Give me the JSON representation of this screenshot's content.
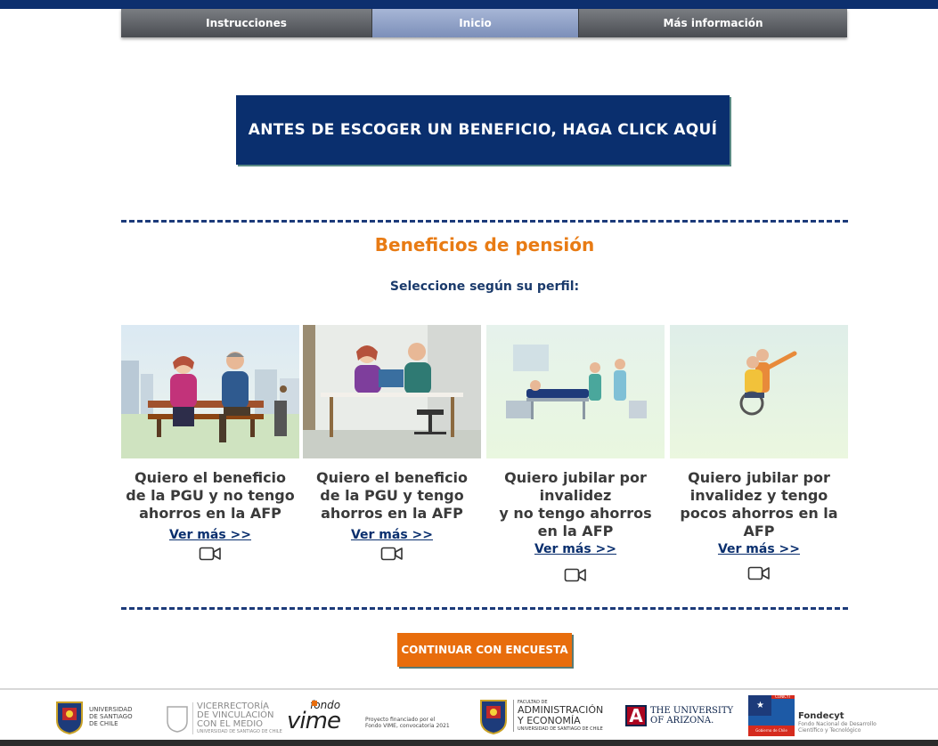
{
  "nav": {
    "tabs": [
      {
        "label": "Instrucciones",
        "active": false
      },
      {
        "label": "Inicio",
        "active": true
      },
      {
        "label": "Más información",
        "active": false
      }
    ]
  },
  "cta": {
    "label": "ANTES DE ESCOGER UN BENEFICIO, HAGA CLICK AQUÍ"
  },
  "section": {
    "title": "Beneficios de pensión",
    "subtitle": "Seleccione según su perfil:"
  },
  "cards": [
    {
      "title_lines": [
        "Quiero el beneficio",
        "de la PGU y no tengo",
        "ahorros en la AFP"
      ],
      "link": "Ver más >>",
      "icon": "video-camera-icon"
    },
    {
      "title_lines": [
        "Quiero el beneficio",
        "de la PGU y tengo",
        "ahorros en la AFP"
      ],
      "link": "Ver más >>",
      "icon": "video-camera-icon"
    },
    {
      "title_lines": [
        "Quiero jubilar por",
        "invalidez",
        "y no tengo ahorros",
        "en la AFP"
      ],
      "link": "Ver más >>",
      "icon": "video-camera-icon"
    },
    {
      "title_lines": [
        "Quiero jubilar por",
        "invalidez y tengo",
        "pocos ahorros en la",
        "AFP"
      ],
      "link": "Ver más >>",
      "icon": "video-camera-icon"
    }
  ],
  "continue": {
    "label": "CONTINUAR CON ENCUESTA"
  },
  "footer": {
    "usach": [
      "UNIVERSIDAD",
      "DE SANTIAGO",
      "DE CHILE"
    ],
    "vicerrectoria": [
      "VICERRECTORÍA",
      "DE VINCULACIÓN",
      "CON EL MEDIO",
      "UNIVERSIDAD DE SANTIAGO DE CHILE"
    ],
    "fondo_vime": {
      "small": "fondo",
      "big": "vime"
    },
    "proyecto": [
      "Proyecto financiado por el",
      "Fondo VIME, convocatoria 2021"
    ],
    "fae": [
      "FACULTAD DE",
      "ADMINISTRACIÓN",
      "Y ECONOMÍA",
      "UNIVERSIDAD DE SANTIAGO DE CHILE"
    ],
    "arizona": [
      "THE UNIVERSITY",
      "OF ARIZONA."
    ],
    "arizona_mark": "A",
    "fondecyt": {
      "title": "Fondecyt",
      "lines": [
        "Fondo Nacional de Desarrollo",
        "Científico y Tecnológico"
      ],
      "seal_top": "CONICYT",
      "seal_bottom": "Gobierno de Chile"
    }
  },
  "colors": {
    "navy": "#0a2f6e",
    "orange": "#e87b14",
    "button_orange": "#e86d0c"
  }
}
